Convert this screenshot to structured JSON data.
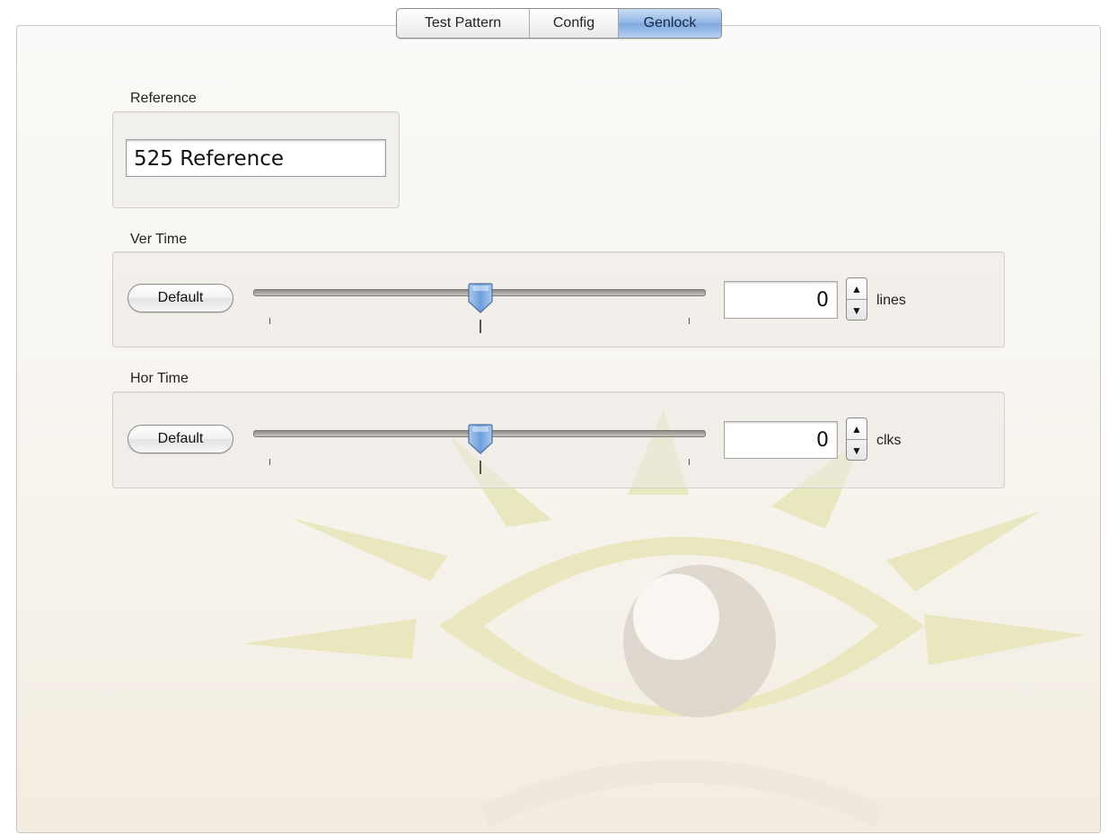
{
  "tabs": [
    {
      "label": "Test Pattern",
      "active": false
    },
    {
      "label": "Config",
      "active": false
    },
    {
      "label": "Genlock",
      "active": true
    }
  ],
  "reference": {
    "group_label": "Reference",
    "value": "525 Reference"
  },
  "ver_time": {
    "group_label": "Ver Time",
    "default_button": "Default",
    "slider_value": 0.5,
    "field_value": "0",
    "unit": "lines"
  },
  "hor_time": {
    "group_label": "Hor Time",
    "default_button": "Default",
    "slider_value": 0.5,
    "field_value": "0",
    "unit": "clks"
  },
  "colors": {
    "active_tab": "#8fb5e6",
    "thumb": "#7fa9dc",
    "watermark_green": "#e6e6b8",
    "watermark_pupil": "#ddd5cc"
  },
  "icons": {
    "watermark": "sunburst-eye-logo",
    "stepper_up": "triangle-up-icon",
    "stepper_down": "triangle-down-icon"
  }
}
